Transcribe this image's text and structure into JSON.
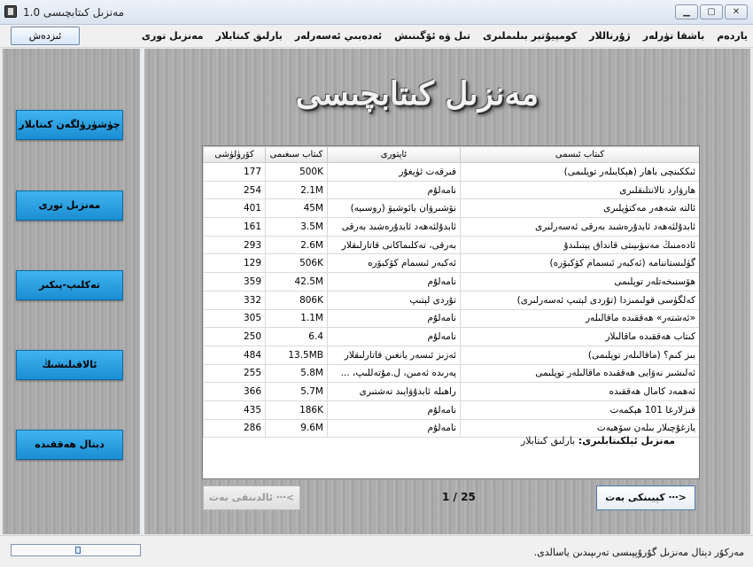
{
  "window": {
    "title": "مەنزىل كىتابچىسى 1.0",
    "controls": {
      "minimize": "▁",
      "maximize": "▢",
      "close": "✕"
    }
  },
  "menu": {
    "items": [
      "مەنزىل تورى",
      "بارلىق كىتابلار",
      "ئەدەبىي ئەسەرلەر",
      "تىل ۋە ئۆگىنىش",
      "كومپيۇتېر بىلىملىرى",
      "ژۇرناللار",
      "باشقا تۈرلەر",
      "ياردەم"
    ],
    "search_label": "ئىزدەش"
  },
  "sidebar": {
    "buttons": [
      "چۈشۈرۈلگەن كىتابلار",
      "مەنزىل تورى",
      "تەكلىپ-پىكىر",
      "ئالاقىلىشىڭ",
      "دېتال ھەققىدە"
    ]
  },
  "brand": {
    "text": "مەنزىل كىتابچىسى"
  },
  "table": {
    "headers": {
      "name": "كىتاب ئىسمى",
      "author": "ئاپتورى",
      "size": "كىتاب سىغىمى",
      "views": "كۆرۈلۈشى"
    },
    "rows": [
      {
        "name": "ئىككىنچى باھار (ھېكايىلەر توپلىمى)",
        "author": "فىرقەت ئۈيغۇر",
        "size": "500K",
        "views": "177"
      },
      {
        "name": "ھارۋارد تالانتلىقلىرى",
        "author": "نامەلۇم",
        "size": "2.1M",
        "views": "254"
      },
      {
        "name": "ئالتە شەھەر مەكتۈپلىرى",
        "author": "نۆشىرۋان يائوشېۋ (روسىيە)",
        "size": "45M",
        "views": "401"
      },
      {
        "name": "ئابدۇلئەھەد ئابدۇرەشىد بەرقى ئەسەرلىرى",
        "author": "ئابدۇلئەھەد ئابدۇرەشىد بەرقى",
        "size": "3.5M",
        "views": "161"
      },
      {
        "name": "ئادەمنىڭ مەنىۋىيىتى قانداق يېتىلىدۇ",
        "author": "بەرقى، تەكلىماكانى قاتارلىقلار",
        "size": "2.6M",
        "views": "293"
      },
      {
        "name": "گۈلىستاننامە (ئەكبەر ئىسمام كۆكبۆرە)",
        "author": "ئەكبەر ئىسمام كۆكبۆرە",
        "size": "506K",
        "views": "129"
      },
      {
        "name": "ھۆسنىخەتلەر توپلىمى",
        "author": "نامەلۇم",
        "size": "42.5M",
        "views": "359"
      },
      {
        "name": "كەلگۈسى قولىمىزدا (تۇردى لېتىپ ئەسەرلىرى)",
        "author": "تۇردى لېتىپ",
        "size": "806K",
        "views": "332"
      },
      {
        "name": "«ئەشتەر» ھەققىدە ماقالىلەر",
        "author": "نامەلۇم",
        "size": "1.1M",
        "views": "305"
      },
      {
        "name": "كىتاب ھەققىدە ماقالىلار",
        "author": "نامەلۇم",
        "size": "6.4",
        "views": "250"
      },
      {
        "name": "بىز كىم؟ (ماقالىلەر توپلىمى)",
        "author": "ئەزىز ئىسەر يانغىن قاتارلىقلار",
        "size": "13.5MB",
        "views": "484"
      },
      {
        "name": "ئەلىشىر نەۋايى ھەققىدە ماقالىلەر توپلىمى",
        "author": "پەرىدە ئەمىن، ل.مۇتەللىپ، ...",
        "size": "5.8M",
        "views": "255"
      },
      {
        "name": "ئەھمەد كامال ھەققىدە",
        "author": "راھىلە ئابدۇۋايىد تەشتىرى",
        "size": "5.7M",
        "views": "366"
      },
      {
        "name": "قىزلارغا 101 ھېكمەت",
        "author": "نامەلۇم",
        "size": "186K",
        "views": "435"
      },
      {
        "name": "يازغۇچىلار بىلەن سۆھبەت",
        "author": "نامەلۇم",
        "size": "9.6M",
        "views": "286"
      }
    ]
  },
  "summary": {
    "label": "مەنزىل ئېلكىتابلىرى:",
    "value": "بارلىق كىتابلار"
  },
  "pagination": {
    "next_label": "كېيىنكى بەت ⋯>",
    "prev_label": "ئالدىنقى بەت ⋯<",
    "indicator": "1 / 25"
  },
  "statusbar": {
    "text": "مەركۇر دېتال مەنزىل گۇرۇپپىسى تەرىپىدىن ياسالدى."
  }
}
